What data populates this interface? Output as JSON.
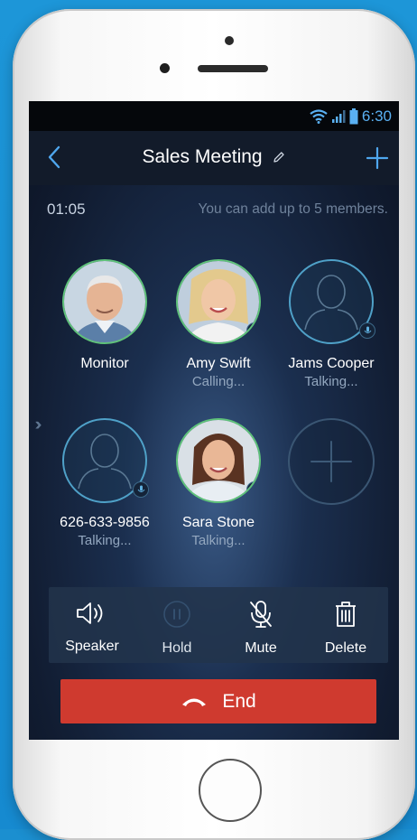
{
  "status": {
    "time": "6:30"
  },
  "header": {
    "title": "Sales Meeting"
  },
  "call": {
    "timer": "01:05",
    "hint": "You can add up to 5 members."
  },
  "members": [
    {
      "name": "Monitor",
      "status": ""
    },
    {
      "name": "Amy Swift",
      "status": "Calling..."
    },
    {
      "name": "Jams Cooper",
      "status": "Talking..."
    },
    {
      "name": "626-633-9856",
      "status": "Talking..."
    },
    {
      "name": "Sara Stone",
      "status": "Talking..."
    }
  ],
  "controls": {
    "speaker": "Speaker",
    "hold": "Hold",
    "mute": "Mute",
    "delete": "Delete"
  },
  "end": {
    "label": "End"
  },
  "colors": {
    "accent": "#4fa7ee",
    "end": "#cf3a2f",
    "online": "#5fc27a"
  }
}
